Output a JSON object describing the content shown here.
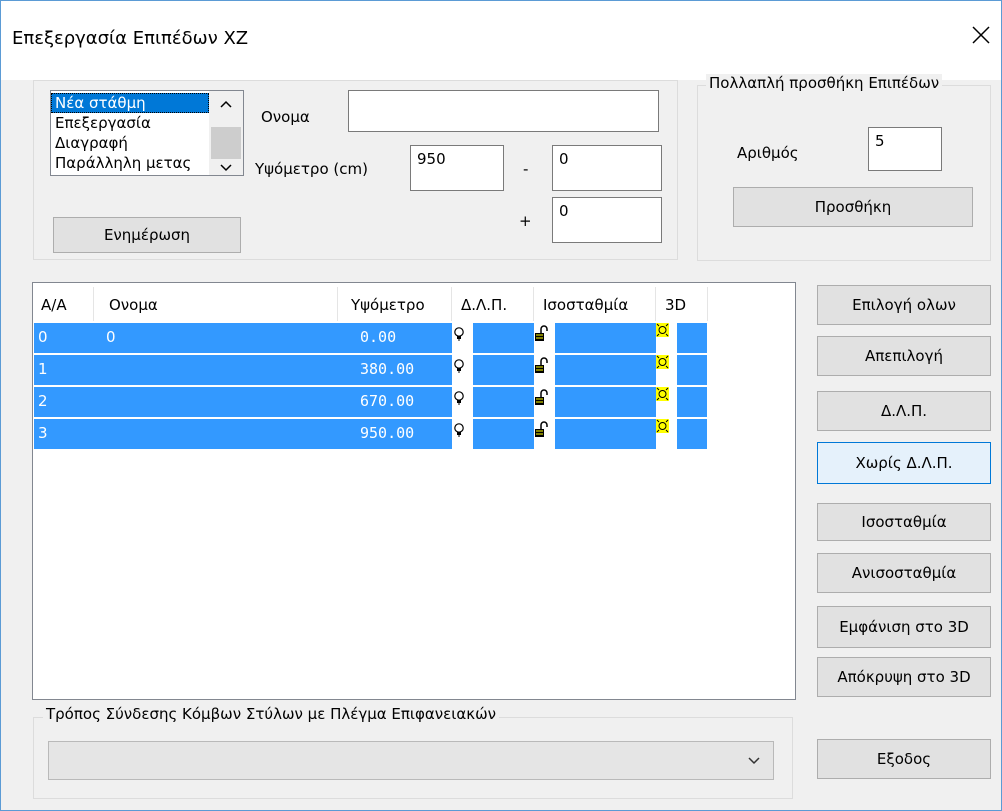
{
  "window": {
    "title": "Επεξεργασία Επιπέδων XZ"
  },
  "actions_list": {
    "items": [
      "Νέα στάθμη",
      "Επεξεργασία",
      "Διαγραφή",
      "Παράλληλη μετας"
    ],
    "selected": "Νέα στάθμη"
  },
  "form": {
    "name_label": "Ονομα",
    "name_value": "",
    "elevation_label": "Υψόμετρο (cm)",
    "elevation_value": "950",
    "minus_sign": "-",
    "minus_value": "0",
    "plus_sign": "+",
    "plus_value": "0",
    "update_button": "Ενημέρωση"
  },
  "multi_add": {
    "group_label": "Πολλαπλή προσθήκη Επιπέδων",
    "count_label": "Αριθμός",
    "count_value": "5",
    "add_button": "Προσθήκη"
  },
  "table": {
    "headers": [
      "Α/Α",
      "Ονομα",
      "Υψόμετρο",
      "Δ.Λ.Π.",
      "Ισοσταθμία",
      "3D"
    ],
    "rows": [
      {
        "index": "0",
        "name": "0",
        "elevation": "0.00"
      },
      {
        "index": "1",
        "name": "",
        "elevation": "380.00"
      },
      {
        "index": "2",
        "name": "",
        "elevation": "670.00"
      },
      {
        "index": "3",
        "name": "",
        "elevation": "950.00"
      }
    ]
  },
  "side_buttons": {
    "select_all": "Επιλογή ολων",
    "deselect": "Απεπιλογή",
    "dlp": "Δ.Λ.Π.",
    "no_dlp": "Χωρίς Δ.Λ.Π.",
    "level": "Ισοσταθμία",
    "unlevel": "Ανισοσταθμία",
    "show_3d": "Εμφάνιση στο 3D",
    "hide_3d": "Απόκρυψη στο 3D",
    "exit": "Εξοδος"
  },
  "connection": {
    "group_label": "Τρόπος Σύνδεσης Κόμβων Στύλων με Πλέγμα Επιφανειακών",
    "selected_value": ""
  },
  "colors": {
    "selection": "#3399ff",
    "accent": "#0078d7",
    "background": "#f0f0f0"
  }
}
